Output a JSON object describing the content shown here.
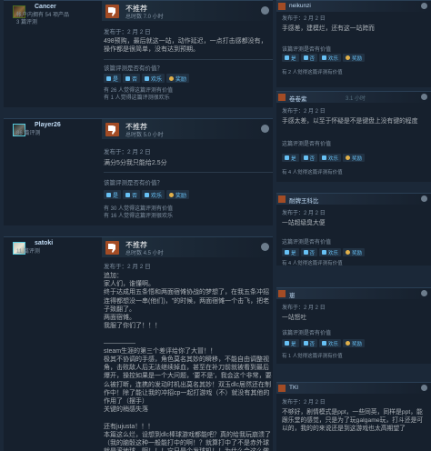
{
  "reviews": [
    {
      "author": "Cancer",
      "meta": [
        "帐户内拥有 54 项产品",
        "3 篇评测"
      ],
      "verdict": "不推荐",
      "verdict_meta": "总时数 7.0 小时",
      "posted": "发布于：2 月 2 日",
      "body": "498预购，最后就这一站，动作延迟，一点打击感都没有，操作都是很简单，没有达到预期。",
      "helpful_q": "该篇评测是否有价值？",
      "votes": [
        "是",
        "否",
        "欢乐",
        "奖励"
      ],
      "stats": [
        "有 26 人觉得这篇评测有价值",
        "有 1 人觉得这篇评测很欢乐"
      ]
    },
    {
      "author": "Player26",
      "meta": [
        "86 篇评测"
      ],
      "verdict": "不推荐",
      "verdict_meta": "总时数 5.0 小时",
      "posted": "发布于：2 月 2 日",
      "body": "满分5分我只能给2.5分",
      "helpful_q": "该篇评测是否有价值？",
      "votes": [
        "是",
        "否",
        "欢乐",
        "奖励"
      ],
      "stats": [
        "有 30 人觉得这篇评测有价值",
        "有 16 人觉得这篇评测很欢乐"
      ]
    },
    {
      "author": "satoki",
      "meta": [
        "11 篇评测"
      ],
      "verdict": "不推荐",
      "verdict_meta": "总时数 4.5 小时",
      "posted": "发布于：2 月 2 日",
      "body": "追加：\n家人们，谁懂啊。\n终于达成用五条悟和两面宿傩协战的梦想了，在我五条冲招连得都想没一串(他们)，\"的时候，两面宿傩一个击飞，把老子致翻了。\n两面宿傩。\n我服了你们了！！！\n\n—————\nsteam生涯的第三个差评给你了大冒！！\n极其不协调的手感，角色莫名其妙的瞬移，不能自由调整视角，击败敌人后无法继续掉血，甚至在补刀前就被看到最后爆开，操控如果是一个大问题，'要不是'，我会这个非常，要么被打断，连携的发动时机出莫名其妙！双玉dlc居然还在制作中！除了能让我的冲招cp一起打游戏（不）就没有其他的作用了（摆手）\n关键的稍感失落\n\n还有jujusta！！！\n本篇这么烂，设想到dlc棒球游戏都能吧？真的给我玩崩溃了（我的脑骰这种一般能打中的啊！？就算打中了不是赤外球就是滚地球，啊！！！它只是个发球机！！为什么会这么做啊\n\n我不退款，是因为这钱是花在咒术这个ip的。也就剩们撑了咒回"
    }
  ],
  "comments": [
    {
      "name": "neikunzi",
      "date": "2 月 2 日",
      "score": "0.7 小时",
      "text": "手感差，建模烂，还有这一站跨而",
      "helpful_q": "该篇评测是否有价值",
      "votes": [
        "是",
        "否",
        "欢乐",
        "奖励"
      ],
      "stat": "有 2 人觉得这篇评测有价值"
    },
    {
      "name": "卷卷紫",
      "date": "2 月 2 日",
      "score": "3.1 小时",
      "text": "手感太差，以至于怀疑是不是键盘上没有键的程度",
      "helpful_q": "这篇评测是否有价值",
      "votes": [
        "是",
        "否",
        "欢乐",
        "奖励"
      ],
      "stat": "有 4 人觉得这篇评测有价值"
    },
    {
      "name": "耐牌王科比",
      "date": "2 月 2 日",
      "score": "0.7 小时",
      "text": "一站超级臭大便",
      "helpful_q": "这篇评测是否有价值",
      "votes": [
        "是",
        "否",
        "欢乐",
        "奖励"
      ],
      "stat": "有 4 人觉得这篇评测有价值"
    },
    {
      "name": "崽",
      "date": "2 月 2 日",
      "score": "0.5 小时",
      "text": "一站怒吐",
      "helpful_q": "该篇评测是否有价值",
      "votes": [
        "是",
        "否",
        "欢乐",
        "奖励"
      ],
      "stat": "有 1 人觉得这篇评测有价值"
    },
    {
      "name": "TKI",
      "date": "2 月 2 日",
      "score": "2.3 小时",
      "text": "不够好，剧情模式是ppt，一些同英，同样是ppt，能跟乐堂的感觉，只是为了玩galgame玩，打斗还是可以的，我的的来说还是到这游戏也太高期望了",
      "helpful_q": "",
      "votes": [],
      "stat": ""
    }
  ],
  "colors": {
    "bg": "#1b2838",
    "panel": "#16202d",
    "accent": "#67c1f5",
    "thumb_down": "#a34c25"
  },
  "icons": {
    "thumb": "thumbs-down-icon",
    "steam": "steam-icon",
    "award": "award-icon"
  }
}
